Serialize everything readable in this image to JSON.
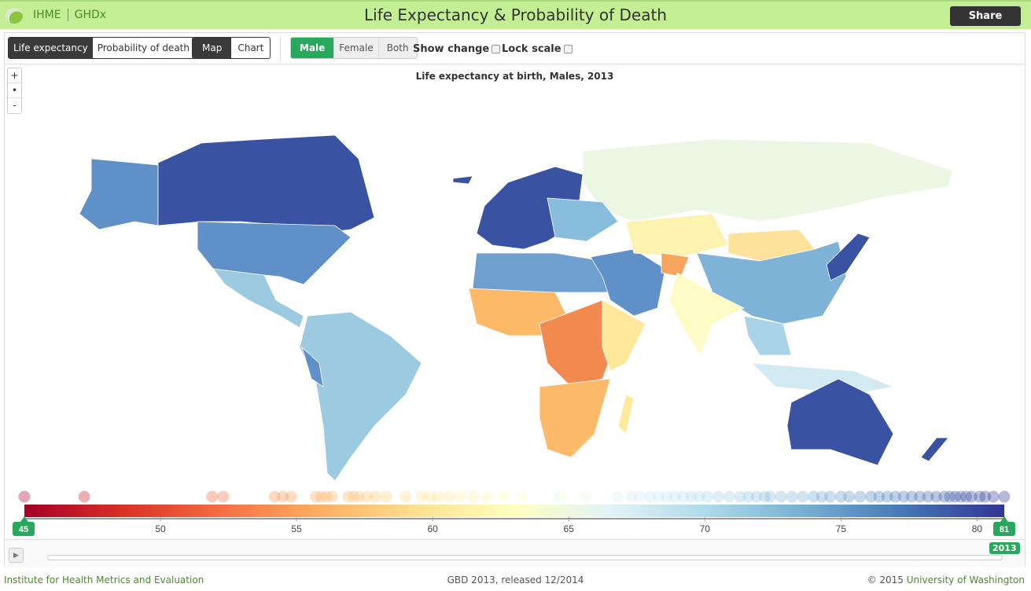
{
  "header": {
    "brand_left": "IHME",
    "brand_right": "GHDx",
    "title": "Life Expectancy & Probability of Death",
    "share_label": "Share"
  },
  "toolbar": {
    "measure": [
      {
        "label": "Life expectancy",
        "active": true
      },
      {
        "label": "Probability of death",
        "active": false
      }
    ],
    "view": [
      {
        "label": "Map",
        "active": true
      },
      {
        "label": "Chart",
        "active": false
      }
    ],
    "sex": [
      {
        "label": "Male",
        "active": true
      },
      {
        "label": "Female",
        "active": false
      },
      {
        "label": "Both",
        "active": false
      }
    ],
    "show_change": {
      "label": "Show change",
      "checked": false
    },
    "lock_scale": {
      "label": "Lock scale",
      "checked": false
    }
  },
  "zoom_controls": {
    "in": "+",
    "reset": "•",
    "out": "-"
  },
  "map": {
    "title": "Life expectancy at birth, Males, 2013",
    "no_data_color": "#e8f5e0"
  },
  "legend": {
    "min": 45,
    "max": 81,
    "min_label": "45",
    "max_label": "81",
    "ticks": [
      "50",
      "55",
      "60",
      "65",
      "70",
      "75",
      "80"
    ],
    "colors": [
      "#a50026",
      "#d73027",
      "#f46d43",
      "#fdae61",
      "#fee090",
      "#ffffbf",
      "#e0f3f8",
      "#abd9e9",
      "#74add1",
      "#4575b4",
      "#313695"
    ],
    "country_values": [
      45.0,
      47.2,
      51.9,
      52.3,
      54.2,
      54.5,
      54.8,
      55.7,
      55.9,
      56.1,
      56.3,
      56.9,
      57.1,
      57.3,
      57.6,
      57.9,
      58.3,
      59.0,
      59.6,
      59.9,
      60.2,
      60.6,
      61.0,
      61.5,
      62.0,
      62.6,
      63.3,
      64.7,
      65.6,
      66.8,
      67.3,
      67.6,
      68.0,
      68.3,
      68.6,
      68.9,
      69.2,
      69.5,
      69.8,
      70.1,
      70.5,
      70.9,
      71.3,
      71.6,
      71.9,
      72.2,
      72.4,
      72.8,
      73.2,
      73.6,
      74.0,
      74.3,
      74.6,
      75.0,
      75.3,
      75.7,
      76.1,
      76.4,
      76.7,
      77.0,
      77.3,
      77.6,
      77.9,
      78.2,
      78.5,
      78.8,
      79.0,
      79.2,
      79.4,
      79.6,
      79.8,
      80.1,
      80.3,
      80.6,
      81.0
    ]
  },
  "timeline": {
    "year": "2013"
  },
  "footer": {
    "left": "Institute for Health Metrics and Evaluation",
    "center": "GBD 2013, released 12/2014",
    "right_prefix": "© 2015 ",
    "right_link": "University of Washington"
  }
}
